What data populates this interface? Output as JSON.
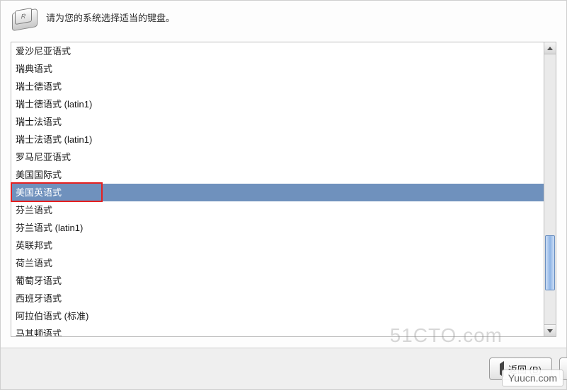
{
  "header": {
    "prompt": "请为您的系统选择适当的键盘。",
    "icon_key_glyph": "R"
  },
  "keyboard_list": {
    "items": [
      {
        "label": "爱沙尼亚语式",
        "selected": false
      },
      {
        "label": "瑞典语式",
        "selected": false
      },
      {
        "label": "瑞士德语式",
        "selected": false
      },
      {
        "label": "瑞士德语式 (latin1)",
        "selected": false
      },
      {
        "label": "瑞士法语式",
        "selected": false
      },
      {
        "label": "瑞士法语式 (latin1)",
        "selected": false
      },
      {
        "label": "罗马尼亚语式",
        "selected": false
      },
      {
        "label": "美国国际式",
        "selected": false
      },
      {
        "label": "美国英语式",
        "selected": true
      },
      {
        "label": "芬兰语式",
        "selected": false
      },
      {
        "label": "芬兰语式 (latin1)",
        "selected": false
      },
      {
        "label": "英联邦式",
        "selected": false
      },
      {
        "label": "荷兰语式",
        "selected": false
      },
      {
        "label": "葡萄牙语式",
        "selected": false
      },
      {
        "label": "西班牙语式",
        "selected": false
      },
      {
        "label": "阿拉伯语式 (标准)",
        "selected": false
      },
      {
        "label": "马其顿语式",
        "selected": false
      }
    ],
    "highlighted_index": 8
  },
  "footer": {
    "back": {
      "label": "返回",
      "mnemonic": "B"
    }
  },
  "watermarks": {
    "w1": "51CTO.com",
    "w2": "Yuucn.com"
  },
  "colors": {
    "selection": "#6f91bd",
    "highlight_border": "#e52020",
    "footer_bg": "#efefef"
  }
}
